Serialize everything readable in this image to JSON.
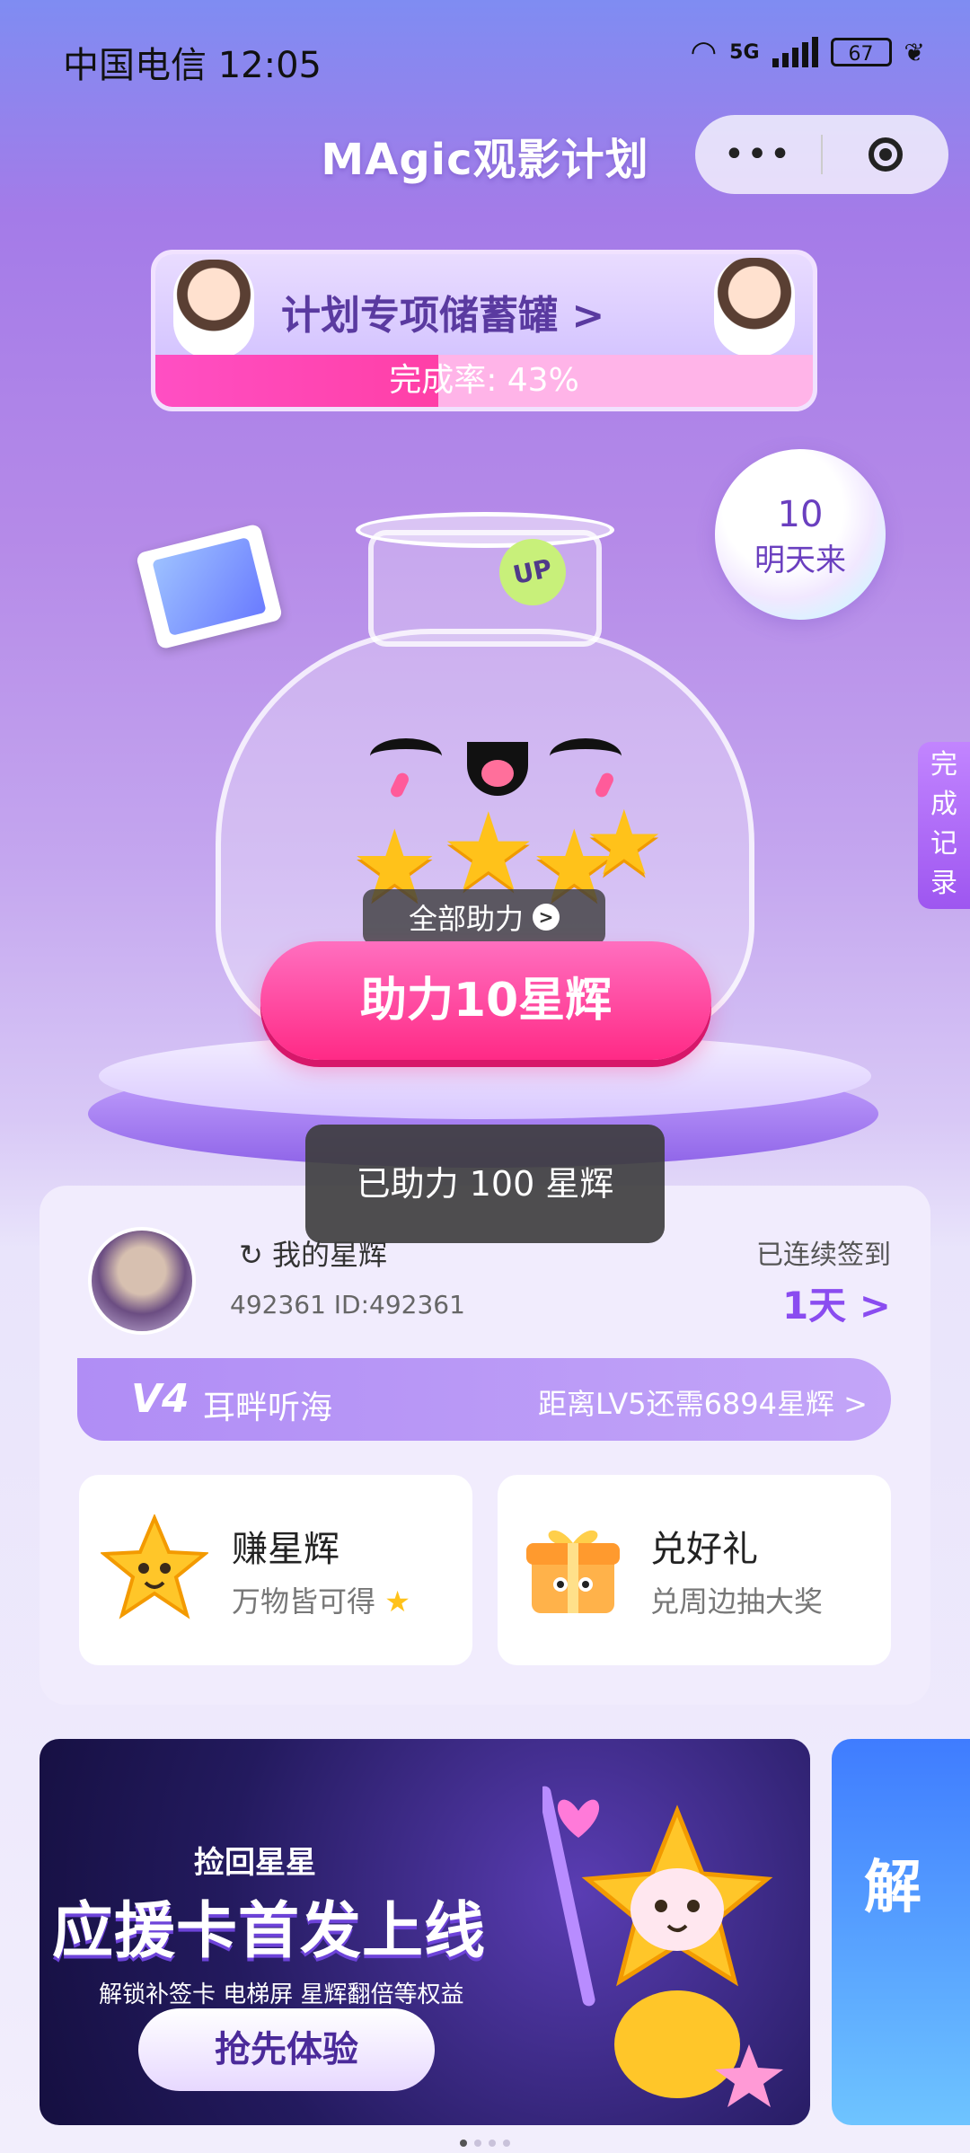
{
  "status_bar": {
    "carrier_time": "中国电信 12:05",
    "network": "5G",
    "battery": "67"
  },
  "header": {
    "title": "MAgic观影计划",
    "menu_dots": "•••"
  },
  "plan_banner": {
    "title": "计划专项储蓄罐",
    "arrow": ">",
    "completion_label": "完成率: 43%",
    "completion_percent": 43
  },
  "bubble": {
    "count": "10",
    "label": "明天来"
  },
  "side_tab": {
    "label": "完成记录"
  },
  "jar": {
    "up_badge": "UP"
  },
  "cta": {
    "all_help": "全部助力",
    "help_button": "助力10星辉"
  },
  "toast": {
    "message": "已助力 100 星辉"
  },
  "user": {
    "stars_line": "我的星辉",
    "id_line": "492361 ID:492361",
    "checkin_label": "已连续签到",
    "checkin_value": "1天 >"
  },
  "level": {
    "tag": "V4",
    "name": "耳畔听海",
    "next_text": "距离LV5还需6894星辉 >"
  },
  "tiles": [
    {
      "title": "赚星辉",
      "subtitle": "万物皆可得",
      "icon": "star-mascot-icon"
    },
    {
      "title": "兑好礼",
      "subtitle": "兑周边抽大奖",
      "icon": "gift-box-icon"
    }
  ],
  "promo": {
    "kicker": "捡回星星",
    "title": "应援卡首发上线",
    "subtitle": "解锁补签卡 电梯屏 星辉翻倍等权益",
    "button": "抢先体验"
  },
  "promo2": {
    "text": "解"
  },
  "colors": {
    "accent": "#8a4cf0",
    "pink": "#ff2a86"
  }
}
